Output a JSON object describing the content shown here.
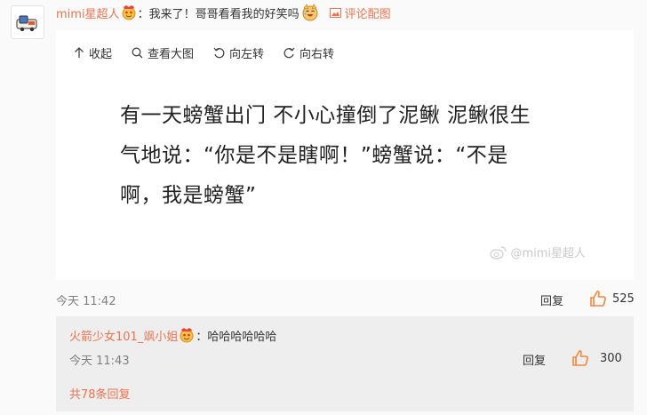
{
  "comment": {
    "username": "mimi星超人",
    "colon": "：",
    "text": "我来了！哥哥看看我的好笑吗",
    "pic_link": "评论配图",
    "time": "今天 11:42",
    "reply_label": "回复",
    "like_count": "525"
  },
  "image_toolbar": {
    "collapse": "收起",
    "view_large": "查看大图",
    "rotate_left": "向左转",
    "rotate_right": "向右转"
  },
  "image": {
    "joke_line1": "有一天螃蟹出门 不小心撞倒了泥鳅 泥鳅很生",
    "joke_line2": "气地说：“你是不是瞎啊！”螃蟹说：“不是",
    "joke_line3": "啊，我是螃蟹”",
    "watermark": "@mimi星超人"
  },
  "sub_comment": {
    "username": "火箭少女101_飒小姐",
    "colon": "：",
    "text": "哈哈哈哈哈哈",
    "time": "今天 11:43",
    "reply_label": "回复",
    "like_count": "300"
  },
  "total_replies": "共78条回复",
  "colors": {
    "accent": "#eb7350",
    "like_orange": "#f0883e"
  },
  "icons": [
    "avatar-icon",
    "vip-badge-icon",
    "laughing-dog-emoji",
    "image-icon",
    "arrow-up-icon",
    "magnifier-icon",
    "rotate-left-icon",
    "rotate-right-icon",
    "weibo-logo-icon",
    "thumbs-up-icon"
  ]
}
